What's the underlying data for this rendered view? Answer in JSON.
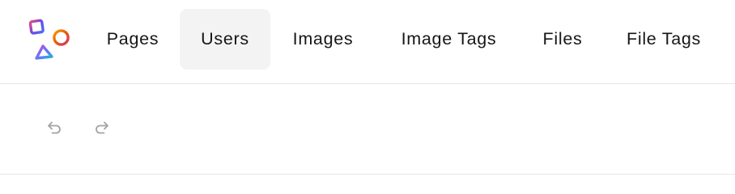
{
  "nav": {
    "items": [
      {
        "label": "Pages",
        "active": false
      },
      {
        "label": "Users",
        "active": true
      },
      {
        "label": "Images",
        "active": false
      },
      {
        "label": "Image Tags",
        "active": false
      },
      {
        "label": "Files",
        "active": false
      },
      {
        "label": "File Tags",
        "active": false
      }
    ]
  },
  "logo": {
    "icon": "shapes-logo-icon",
    "colors": [
      "#3b5bdb",
      "#e8590c",
      "#be4bdb"
    ]
  },
  "toolbar": {
    "undo_icon": "undo-icon",
    "redo_icon": "redo-icon",
    "icon_color": "#a3a3a3"
  },
  "colors": {
    "active_tab_bg": "#f3f3f4",
    "divider": "#e6e6e8",
    "text": "#161616"
  }
}
